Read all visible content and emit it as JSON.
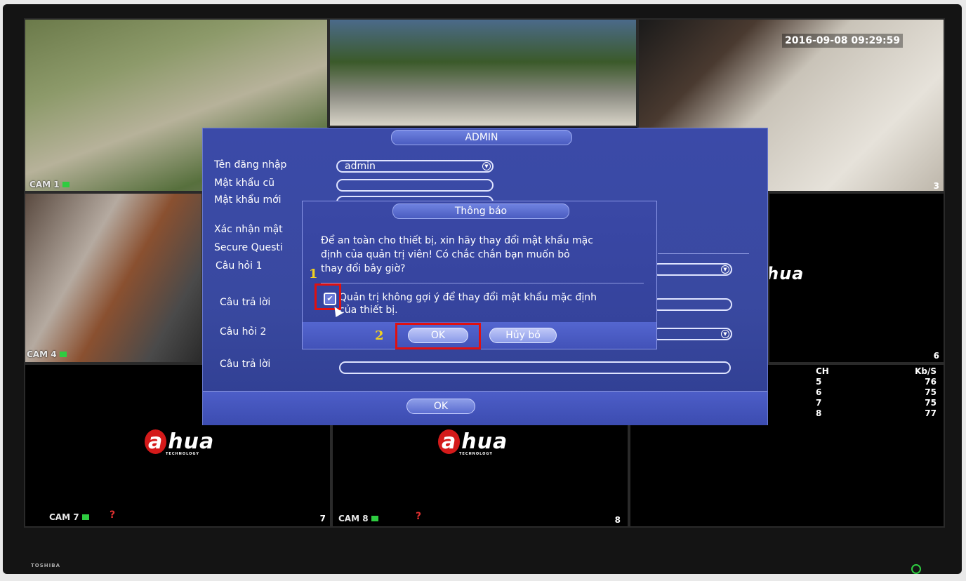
{
  "screen": {
    "timestamp": "2016-09-08 09:29:59",
    "cameras": [
      {
        "id": "cam1",
        "label": "CAM 1"
      },
      {
        "id": "cam4",
        "label": "CAM 4"
      },
      {
        "id": "cam7",
        "label": "CAM 7"
      },
      {
        "id": "cam8",
        "label": "CAM 8"
      }
    ],
    "tile_numbers": {
      "t3": "3",
      "t6": "6",
      "t7": "7",
      "t8": "8"
    },
    "logo_text": "hua",
    "logo_prefix": "a",
    "logo_sub": "TECHNOLOGY",
    "bitrate": {
      "headers": [
        "CH",
        "Kb/S"
      ],
      "rows": [
        {
          "ch": "5",
          "kbs": "76"
        },
        {
          "ch": "6",
          "kbs": "75"
        },
        {
          "ch": "7",
          "kbs": "75"
        },
        {
          "ch": "8",
          "kbs": "77"
        }
      ]
    },
    "missing_signal_icon": "question-mark"
  },
  "admin_dialog": {
    "title": "ADMIN",
    "labels": {
      "username": "Tên đăng nhập",
      "old_password": "Mật khẩu cũ",
      "new_password": "Mật khẩu mới",
      "confirm_password": "Xác nhận mật",
      "secure_question": "Secure Questi",
      "question1": "Câu hỏi 1",
      "answer1": "Câu trả lời",
      "question2": "Câu hỏi 2",
      "answer2": "Câu trả lời"
    },
    "username_value": "admin",
    "ok_label": "OK"
  },
  "notice_dialog": {
    "title": "Thông báo",
    "message_line1": "Để an toàn cho thiết bị, xin hãy thay đổi mật khẩu mặc",
    "message_line2": "định của quản trị viên! Có chắc chắn bạn muốn bỏ",
    "message_line3": "thay đổi bây giờ?",
    "checkbox_label_line1": "Quản trị không gợi ý để thay đổi mật khẩu mặc định",
    "checkbox_label_line2": "của thiết bị.",
    "checkbox_checked": true,
    "ok_label": "OK",
    "cancel_label": "Hủy bỏ"
  },
  "annotations": {
    "step1": "1",
    "step2": "2"
  },
  "monitor": {
    "brand": "TOSHIBA"
  }
}
